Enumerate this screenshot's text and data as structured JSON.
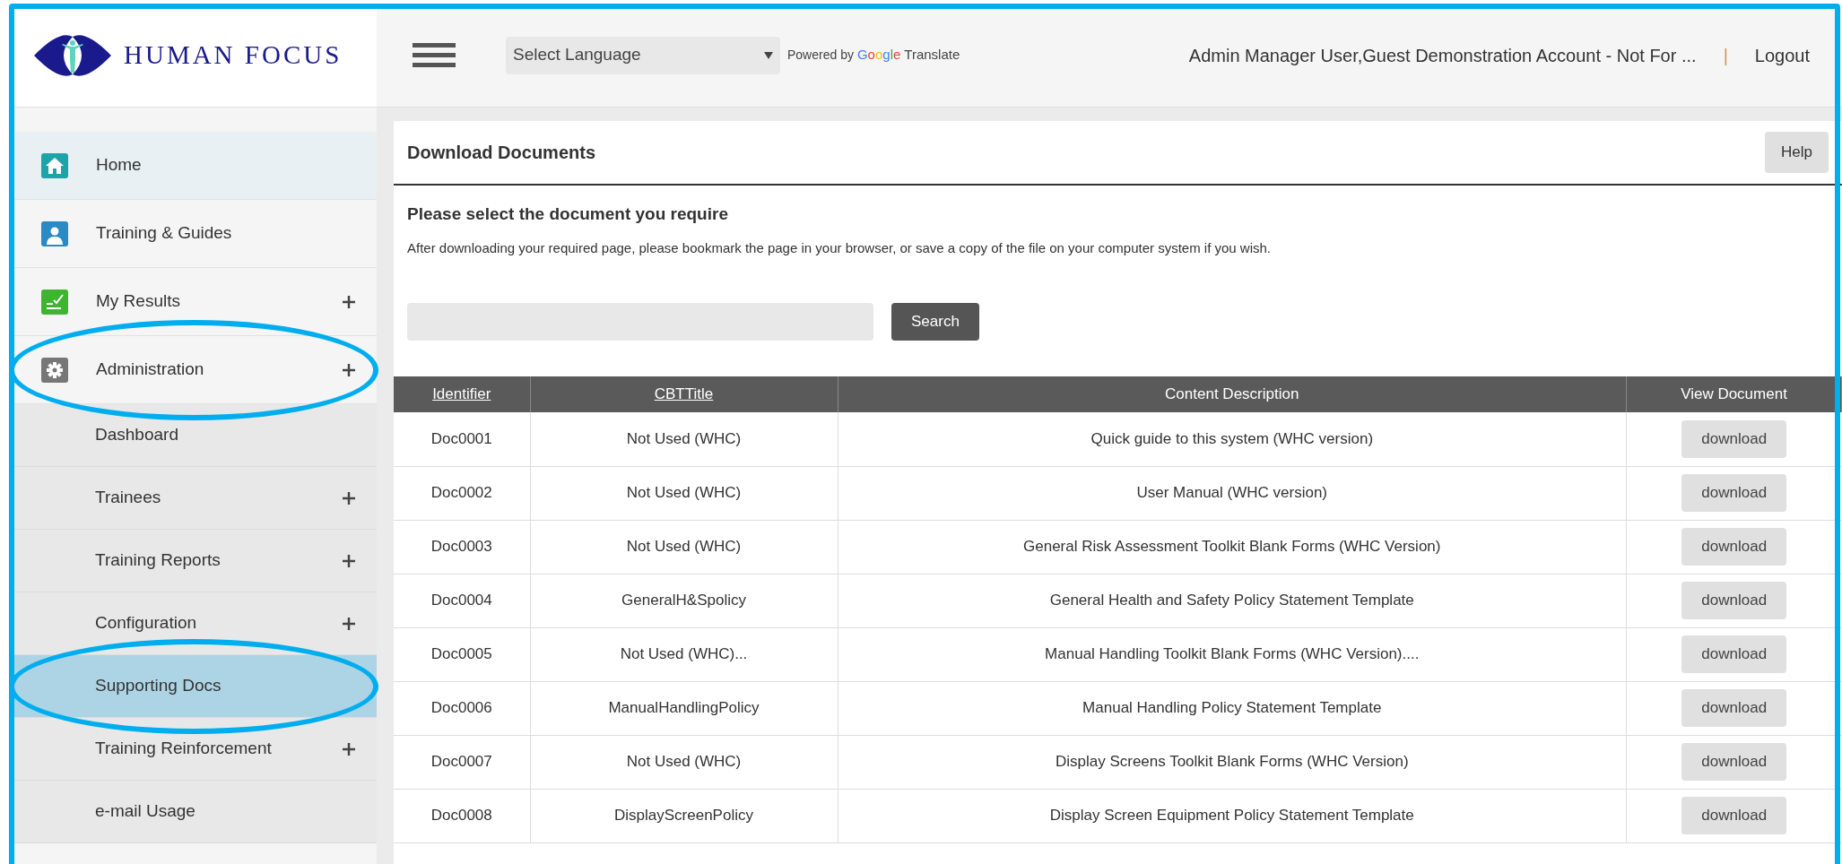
{
  "header": {
    "logo_text": "HUMAN FOCUS",
    "language_select": "Select Language",
    "powered_by": "Powered by",
    "google": "Google",
    "translate": "Translate",
    "user": "Admin Manager User,Guest Demonstration Account - Not For ...",
    "separator": "|",
    "logout": "Logout"
  },
  "sidebar": {
    "items": [
      {
        "label": "Home",
        "kind": "home",
        "expandable": false,
        "selected": true,
        "highlighted": false
      },
      {
        "label": "Training & Guides",
        "kind": "person",
        "expandable": false,
        "selected": false,
        "highlighted": false
      },
      {
        "label": "My Results",
        "kind": "results",
        "expandable": true,
        "selected": false,
        "highlighted": false
      },
      {
        "label": "Administration",
        "kind": "gear",
        "expandable": true,
        "selected": false,
        "highlighted": true,
        "children": [
          {
            "label": "Dashboard",
            "expandable": false,
            "selected": false,
            "highlighted": false
          },
          {
            "label": "Trainees",
            "expandable": true,
            "selected": false,
            "highlighted": false
          },
          {
            "label": "Training Reports",
            "expandable": true,
            "selected": false,
            "highlighted": false
          },
          {
            "label": "Configuration",
            "expandable": true,
            "selected": false,
            "highlighted": false
          },
          {
            "label": "Supporting Docs",
            "expandable": false,
            "selected": true,
            "highlighted": true
          },
          {
            "label": "Training Reinforcement",
            "expandable": true,
            "selected": false,
            "highlighted": false
          },
          {
            "label": "e-mail Usage",
            "expandable": false,
            "selected": false,
            "highlighted": false
          }
        ]
      }
    ]
  },
  "panel": {
    "title": "Download Documents",
    "help": "Help",
    "heading": "Please select the document you require",
    "intro": "After downloading your required page, please bookmark the page in your browser, or save a copy of the file on your computer system if you wish.",
    "search_button": "Search"
  },
  "table": {
    "columns": [
      {
        "label": "Identifier",
        "sortable": true
      },
      {
        "label": "CBTTitle",
        "sortable": true
      },
      {
        "label": "Content Description",
        "sortable": false
      },
      {
        "label": "View Document",
        "sortable": false
      }
    ],
    "rows": [
      {
        "identifier": "Doc0001",
        "title": "Not Used (WHC)",
        "description": "Quick guide to this system (WHC version)",
        "action": "download"
      },
      {
        "identifier": "Doc0002",
        "title": "Not Used (WHC)",
        "description": "User Manual (WHC version)",
        "action": "download"
      },
      {
        "identifier": "Doc0003",
        "title": "Not Used (WHC)",
        "description": "General Risk Assessment Toolkit Blank Forms (WHC Version)",
        "action": "download"
      },
      {
        "identifier": "Doc0004",
        "title": "GeneralH&Spolicy",
        "description": "General Health and Safety Policy Statement Template",
        "action": "download"
      },
      {
        "identifier": "Doc0005",
        "title": "Not Used (WHC)...",
        "description": "Manual Handling Toolkit Blank Forms (WHC Version)....",
        "action": "download"
      },
      {
        "identifier": "Doc0006",
        "title": "ManualHandlingPolicy",
        "description": "Manual Handling Policy Statement Template",
        "action": "download"
      },
      {
        "identifier": "Doc0007",
        "title": "Not Used (WHC)",
        "description": "Display Screens Toolkit Blank Forms (WHC Version)",
        "action": "download"
      },
      {
        "identifier": "Doc0008",
        "title": "DisplayScreenPolicy",
        "description": "Display Screen Equipment Policy Statement Template",
        "action": "download"
      }
    ]
  }
}
